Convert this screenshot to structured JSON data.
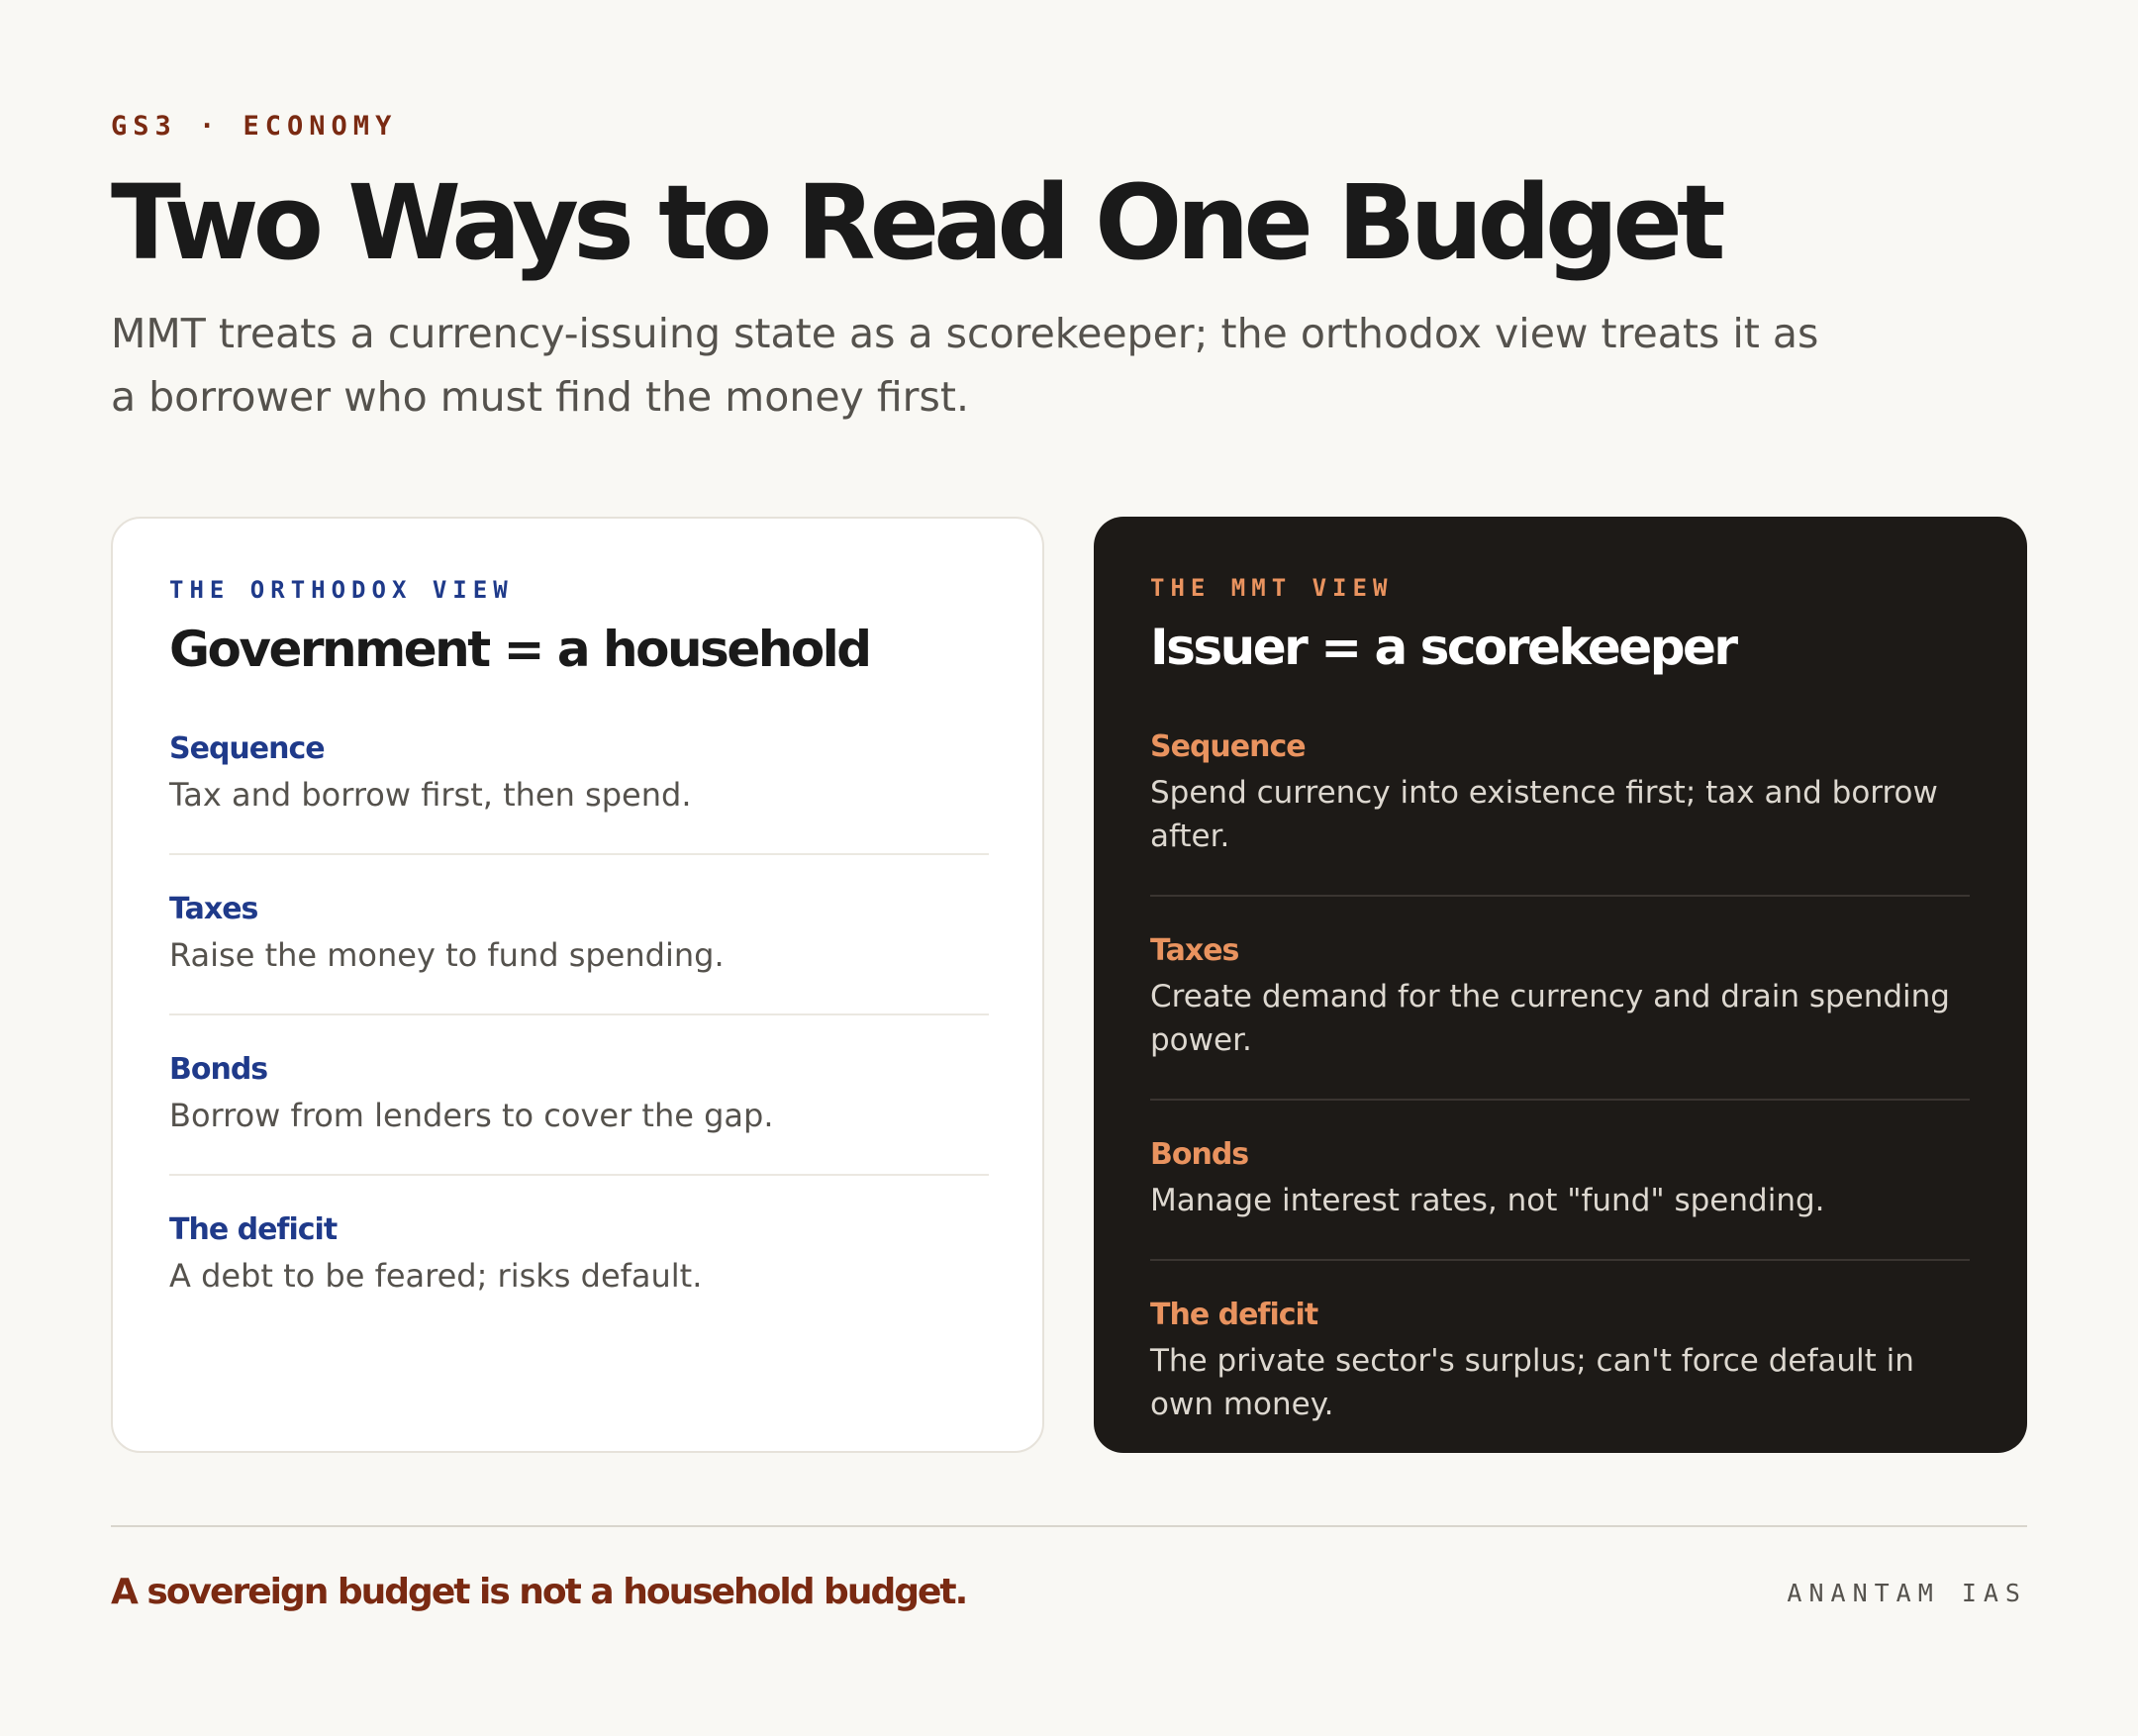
{
  "header": {
    "kicker": "GS3 · ECONOMY",
    "title": "Two Ways to Read One Budget",
    "subtitle": "MMT treats a currency-issuing state as a scorekeeper; the orthodox view treats it as a borrower who must find the money first."
  },
  "cards": [
    {
      "kicker": "THE ORTHODOX VIEW",
      "title": "Government = a household",
      "rows": [
        {
          "label": "Sequence",
          "text": "Tax and borrow first, then spend."
        },
        {
          "label": "Taxes",
          "text": "Raise the money to fund spending."
        },
        {
          "label": "Bonds",
          "text": "Borrow from lenders to cover the gap."
        },
        {
          "label": "The deficit",
          "text": "A debt to be feared; risks default."
        }
      ]
    },
    {
      "kicker": "THE MMT VIEW",
      "title": "Issuer = a scorekeeper",
      "rows": [
        {
          "label": "Sequence",
          "text": "Spend currency into existence first; tax and borrow after."
        },
        {
          "label": "Taxes",
          "text": "Create demand for the currency and drain spending power."
        },
        {
          "label": "Bonds",
          "text": "Manage interest rates, not \"fund\" spending."
        },
        {
          "label": "The deficit",
          "text": "The private sector's surplus; can't force default in own money."
        }
      ]
    }
  ],
  "footer": {
    "tagline": "A sovereign budget is not a household budget.",
    "brand": "ANANTAM IAS"
  },
  "colors": {
    "background": "#f9f8f4",
    "accent_rust": "#7a2a12",
    "orthodox_blue": "#1f3a8a",
    "mmt_orange": "#e9935f",
    "dark_card": "#1d1a17"
  }
}
